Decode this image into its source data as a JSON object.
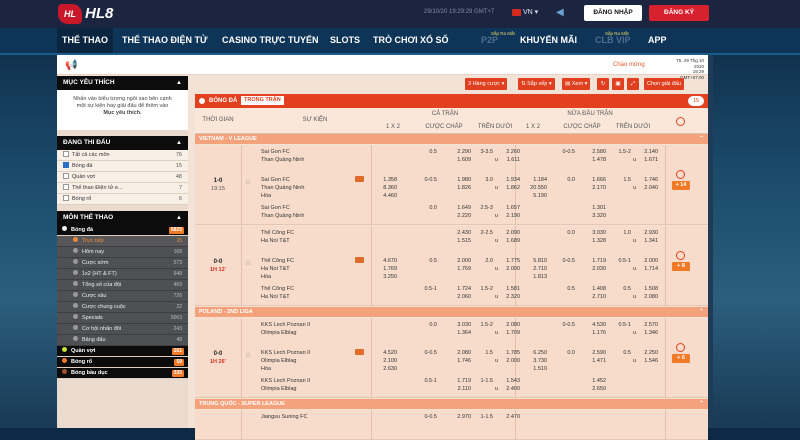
{
  "header": {
    "logo_text": "HL8",
    "logo_badge": "HL",
    "time": "29/10/20 19:29:29 GMT+7",
    "lang": "VN",
    "login": "ĐĂNG NHẬP",
    "register": "ĐĂNG KÝ"
  },
  "nav": [
    {
      "label": "THỂ THAO",
      "active": true
    },
    {
      "label": "THỂ THAO ĐIỆN TỬ"
    },
    {
      "label": "CASINO TRỰC TUYẾN"
    },
    {
      "label": "SLOTS"
    },
    {
      "label": "TRÒ CHƠI"
    },
    {
      "label": "XỔ SỐ"
    },
    {
      "label": "P2P",
      "dim": true,
      "tag": "Sắp Ra Mắt"
    },
    {
      "label": "KHUYẾN MÃI"
    },
    {
      "label": "CLB VIP",
      "dim": true,
      "tag": "Sắp Ra Mắt"
    },
    {
      "label": "APP"
    }
  ],
  "announce": {
    "marquee": "Chào mừng",
    "date1": "T5, 29 Thg 10 2020",
    "date2": "19:29 GMT+07:00"
  },
  "sidebar": {
    "fav_title": "MỤC YÊU THÍCH",
    "fav_text1": "Nhấn vào biểu tượng ngôi sao bên cạnh",
    "fav_text2": "một sự kiện hay giải đấu để thêm vào",
    "fav_text3": "Mục yêu thích.",
    "running_title": "ĐANG THI ĐẤU",
    "running": [
      {
        "label": "Tất cả các môn",
        "count": "76",
        "checked": false
      },
      {
        "label": "Bóng đá",
        "count": "15",
        "checked": true
      },
      {
        "label": "Quần vợt",
        "count": "48",
        "checked": false
      },
      {
        "label": "Thể thao Điện tử e...",
        "count": "7",
        "checked": false
      },
      {
        "label": "Bóng rổ",
        "count": "6",
        "checked": false
      }
    ],
    "sports_title": "MÔN THỂ THAO",
    "sports": [
      {
        "label": "Bóng đá",
        "count": "5825",
        "type": "top",
        "color": "#f2f2f2"
      },
      {
        "label": "Trực tiếp",
        "count": "15",
        "type": "sub",
        "sel": true
      },
      {
        "label": "Hôm nay",
        "count": "168",
        "type": "sub"
      },
      {
        "label": "Cược sớm",
        "count": "573",
        "type": "sub"
      },
      {
        "label": "1x2 (HT & FT)",
        "count": "648",
        "type": "sub"
      },
      {
        "label": "Tổng số của đội",
        "count": "469",
        "type": "sub"
      },
      {
        "label": "Cược xâu",
        "count": "726",
        "type": "sub"
      },
      {
        "label": "Cược chung cuộc",
        "count": "22",
        "type": "sub"
      },
      {
        "label": "Specials",
        "count": "5063",
        "type": "sub"
      },
      {
        "label": "Cơ hội nhân đôi",
        "count": "243",
        "type": "sub"
      },
      {
        "label": "Bảng đấu",
        "count": "48",
        "type": "sub"
      },
      {
        "label": "Quần vợt",
        "count": "161",
        "type": "top",
        "color": "#c9e23a"
      },
      {
        "label": "Bóng rổ",
        "count": "59",
        "type": "top",
        "color": "#f07a28"
      },
      {
        "label": "Bóng bầu dục",
        "count": "335",
        "type": "top",
        "color": "#a0522d"
      }
    ]
  },
  "toolbar": {
    "b1": "3 Hàng cược",
    "b2": "Sắp xếp",
    "b3": "Xem",
    "b4": "Chọn giải đấu"
  },
  "table": {
    "sport": "BÓNG ĐÁ",
    "mode": "TRONG TRẬN",
    "count": "15",
    "h_time": "THỜI GIAN",
    "h_event": "SỰ KIỆN",
    "h_full": "CẢ TRẬN",
    "h_half": "NỬA ĐẦU TRẬN",
    "h_1x2": "1 X 2",
    "h_hdp": "CƯỢC CHẤP",
    "h_ou": "TRÊN DƯỚI"
  },
  "leagues": [
    {
      "name": "VIETNAM - V LEAGUE",
      "matches": [
        {
          "score": "1-0",
          "min": "19:15",
          "min_grey": true,
          "plus": "+ 14",
          "rows": [
            {
              "home": "Sai Gon FC",
              "away": "Than Quảng Ninh",
              "hdp_l": "0.5",
              "hdp_o1": "2.290",
              "hdp_o2": "1.609",
              "ou_l": "3-3.5",
              "ou_s1": "",
              "ou_s2": "u",
              "ou_o1": "2.260",
              "ou_o2": "1.611",
              "h_hdp_l": "0-0.5",
              "h_hdp_o1": "2.580",
              "h_hdp_o2": "1.478",
              "h_ou_l": "1.5-2",
              "h_ou_s2": "u",
              "h_ou_o1": "2.140",
              "h_ou_o2": "1.671"
            },
            {
              "home": "Sai Gon FC",
              "away": "Than Quảng Ninh",
              "draw": "Hòa",
              "x1": "1.358",
              "x2": "8.360",
              "x3": "4.460",
              "hdp_l": "0-0.5",
              "hdp_o1": "1.980",
              "hdp_o2": "1.826",
              "ou_l": "3.0",
              "ou_s2": "u",
              "ou_o1": "1.934",
              "ou_o2": "1.862",
              "hx1": "1.184",
              "hx2": "20.550",
              "hx3": "5.190",
              "h_hdp_l": "0.0",
              "h_hdp_o1": "1.666",
              "h_hdp_o2": "2.170",
              "h_ou_l": "1.5",
              "h_ou_s2": "u",
              "h_ou_o1": "1.746",
              "h_ou_o2": "2.040"
            },
            {
              "home": "Sai Gon FC",
              "away": "Than Quảng Ninh",
              "hdp_l": "0.0",
              "hdp_o1": "1.649",
              "hdp_o2": "2.220",
              "ou_l": "2.5-3",
              "ou_s2": "u",
              "ou_o1": "1.657",
              "ou_o2": "2.190",
              "h_hdp_l": "",
              "h_hdp_o1": "1.301",
              "h_hdp_o2": "3.320"
            }
          ]
        },
        {
          "score": "0-0",
          "min": "1H 12'",
          "plus": "+ 8",
          "rows": [
            {
              "home": "Thể Công FC",
              "away": "Ha Noi T&T",
              "hdp_l": "",
              "hdp_o1": "2.430",
              "hdp_o2": "1.515",
              "ou_l": "2-2.5",
              "ou_s2": "u",
              "ou_o1": "2.090",
              "ou_o2": "1.689",
              "h_hdp_l": "0.0",
              "h_hdp_o1": "3.030",
              "h_hdp_o2": "1.328",
              "h_ou_l": "1.0",
              "h_ou_s2": "u",
              "h_ou_o1": "2.930",
              "h_ou_o2": "1.341"
            },
            {
              "home": "Thể Công FC",
              "away": "Ha Noi T&T",
              "draw": "Hòa",
              "x1": "4.670",
              "x2": "1.769",
              "x3": "3.250",
              "hdp_l": "0.5",
              "hdp_o1": "2.000",
              "hdp_o2": "1.769",
              "ou_l": "2.0",
              "ou_s2": "u",
              "ou_o1": "1.775",
              "ou_o2": "2.000",
              "hx1": "5.810",
              "hx2": "2.710",
              "hx3": "1.813",
              "h_hdp_l": "0-0.5",
              "h_hdp_o1": "1.719",
              "h_hdp_o2": "2.030",
              "h_ou_l": "0.5-1",
              "h_ou_s2": "u",
              "h_ou_o1": "2.000",
              "h_ou_o2": "1.714"
            },
            {
              "home": "Thể Công FC",
              "away": "Ha Noi T&T",
              "hdp_l": "0.5-1",
              "hdp_o1": "1.724",
              "hdp_o2": "2.060",
              "ou_l": "1.5-2",
              "ou_s2": "u",
              "ou_o1": "1.581",
              "ou_o2": "2.320",
              "h_hdp_l": "0.5",
              "h_hdp_o1": "1.408",
              "h_hdp_o2": "2.710",
              "h_ou_l": "0.5",
              "h_ou_s2": "u",
              "h_ou_o1": "1.508",
              "h_ou_o2": "2.080"
            }
          ]
        }
      ]
    },
    {
      "name": "POLAND - 2ND LIGA",
      "matches": [
        {
          "score": "0-0",
          "min": "1H 26'",
          "plus": "+ 6",
          "rows": [
            {
              "home": "KKS Lech Poznan II",
              "away": "Olimpia Elblag",
              "hdp_l": "0.0",
              "hdp_o1": "3.030",
              "hdp_o2": "1.364",
              "ou_l": "1.5-2",
              "ou_s2": "u",
              "ou_o1": "2.080",
              "ou_o2": "1.709",
              "h_hdp_l": "0-0.5",
              "h_hdp_o1": "4.530",
              "h_hdp_o2": "1.176",
              "h_ou_l": "0.5-1",
              "h_ou_s2": "u",
              "h_ou_o1": "2.570",
              "h_ou_o2": "1.346"
            },
            {
              "home": "KKS Lech Poznan II",
              "away": "Olimpia Elblag",
              "draw": "Hòa",
              "x1": "4.520",
              "x2": "2.100",
              "x3": "2.630",
              "hdp_l": "0-0.5",
              "hdp_o1": "2.080",
              "hdp_o2": "1.746",
              "ou_l": "1.5",
              "ou_s2": "u",
              "ou_o1": "1.785",
              "ou_o2": "2.000",
              "hx1": "6.250",
              "hx2": "3.730",
              "hx3": "1.510",
              "h_hdp_l": "0.0",
              "h_hdp_o1": "2.590",
              "h_hdp_o2": "1.471",
              "h_ou_l": "0.5",
              "h_ou_s2": "u",
              "h_ou_o1": "2.250",
              "h_ou_o2": "1.546"
            },
            {
              "home": "KKS Lech Poznan II",
              "away": "Olimpia Elblag",
              "hdp_l": "0.5-1",
              "hdp_o1": "1.719",
              "hdp_o2": "2.110",
              "ou_l": "1-1.5",
              "ou_s2": "u",
              "ou_o1": "1.543",
              "ou_o2": "2.400",
              "h_hdp_l": "",
              "h_hdp_o1": "1.452",
              "h_hdp_o2": "2.650"
            }
          ]
        }
      ]
    },
    {
      "name": "TRUNG QUỐC - SUPER LEAGUE",
      "matches": [
        {
          "score": "",
          "min": "",
          "rows": [
            {
              "home": "Jiangsu Suning FC",
              "away": "",
              "hdp_l": "0-0.5",
              "hdp_o1": "2.970",
              "hdp_o2": "",
              "ou_l": "1-1.5",
              "ou_s2": "",
              "ou_o1": "2.470",
              "ou_o2": ""
            }
          ]
        }
      ]
    }
  ]
}
